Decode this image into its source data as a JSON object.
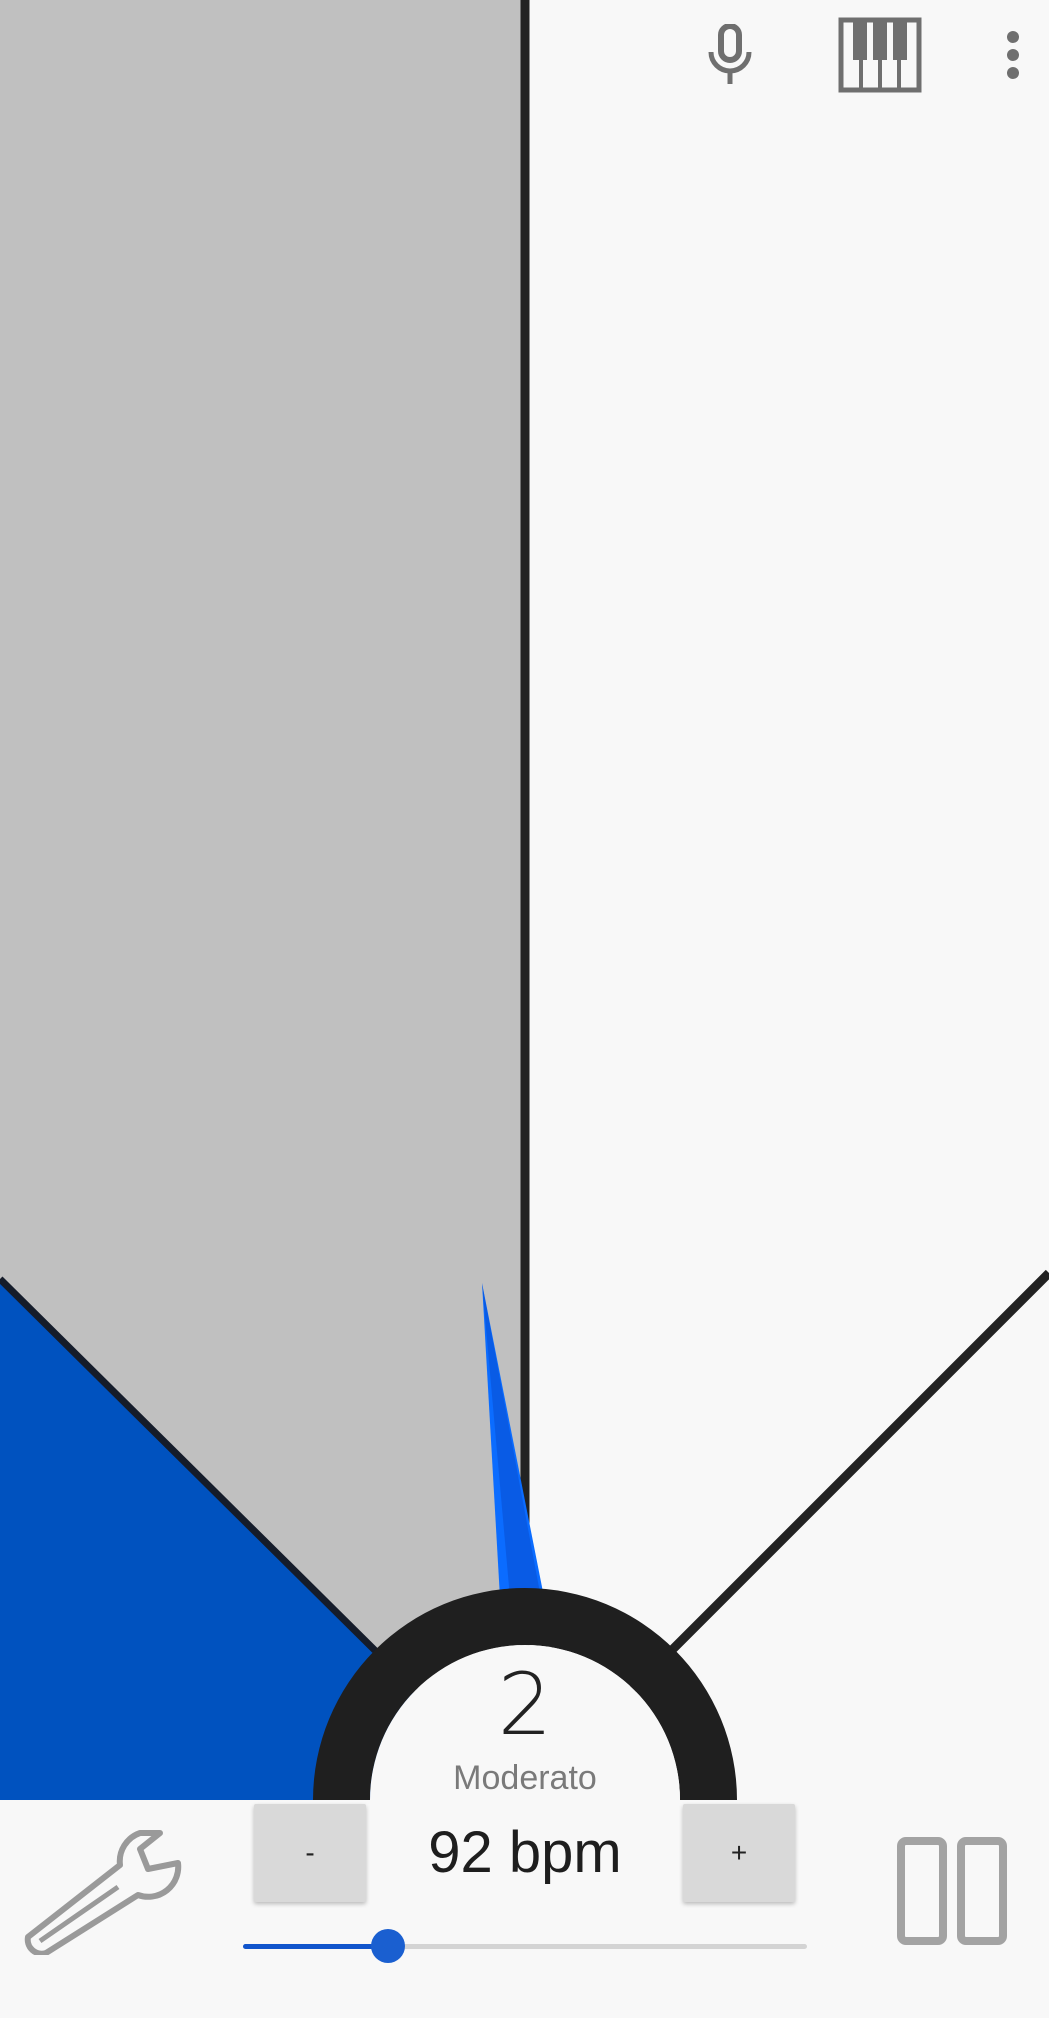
{
  "app": {
    "beat_count": "2",
    "tempo_name": "Moderato",
    "bpm_text": "92 bpm",
    "bpm_value": 92,
    "slider": {
      "min": 20,
      "max": 300,
      "value": 92
    }
  },
  "controls": {
    "minus_label": "-",
    "plus_label": "+"
  },
  "toolbar": {
    "icons": [
      "microphone-icon",
      "piano-keyboard-icon",
      "more-vert-icon"
    ]
  },
  "bottom": {
    "icons": [
      "wrench-icon",
      "pause-icon"
    ]
  },
  "colors": {
    "pendulum_swept": "#0052bf",
    "pendulum_unswept": "#c0c0c0",
    "background": "#f8f8f8",
    "needle": "#0b6cff",
    "needle_shade": "#0a4fcf",
    "accent": "#1155cc",
    "dark": "#222222",
    "icon_gray": "#6f6f6f"
  }
}
